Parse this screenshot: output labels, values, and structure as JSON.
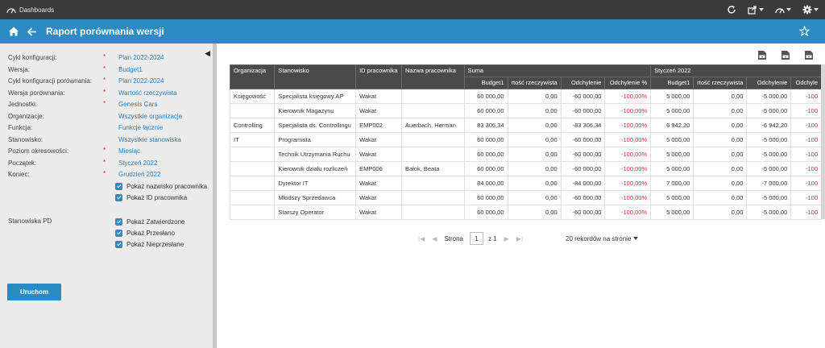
{
  "topbar": {
    "app_name": "Dashboards"
  },
  "header": {
    "title": "Raport porównania wersji"
  },
  "params": [
    {
      "label": "Cykl konfiguracji:",
      "required": "*",
      "value": "Plan 2022-2024"
    },
    {
      "label": "Wersja:",
      "required": "*",
      "value": "Budget1"
    },
    {
      "label": "Cykl konfiguracji porównania:",
      "required": "*",
      "value": "Plan 2022-2024"
    },
    {
      "label": "Wersja porównania:",
      "required": "*",
      "value": "Wartość rzeczywista"
    },
    {
      "label": "Jednostki:",
      "required": "*",
      "value": "Genesis Cars"
    },
    {
      "label": "Organizacje:",
      "required": "",
      "value": "Wszystkie organizacje"
    },
    {
      "label": "Funkcja:",
      "required": "",
      "value": "Funkcje łącznie"
    },
    {
      "label": "Stanowisko:",
      "required": "",
      "value": "Wszystkie stanowiska"
    },
    {
      "label": "Poziom okresowości:",
      "required": "*",
      "value": "Miesiąc"
    },
    {
      "label": "Początek:",
      "required": "*",
      "value": "Styczeń 2022"
    },
    {
      "label": "Koniec:",
      "required": "*",
      "value": "Grudzień 2022"
    }
  ],
  "checks1": [
    "Pokaż nazwisko pracownika",
    "Pokaż ID pracownika"
  ],
  "pd_label": "Stanowiska PD",
  "checks2": [
    "Pokaż Zatwierdzone",
    "Pokaż Przesłano",
    "Pokaż Nieprzesłane"
  ],
  "run_label": "Uruchom",
  "table": {
    "group_headers": {
      "suma": "Suma",
      "jan": "Styczeń 2022"
    },
    "base_headers": [
      "Organizacja",
      "Stanowisko",
      "ID pracownika",
      "Nazwa pracownika"
    ],
    "sub_headers": [
      "Budget1",
      "rtość rzeczywista",
      "Odchylenie",
      "Odchylenie %",
      "Budget1",
      "rtość rzeczywista",
      "Odchylenie",
      "Odchyle"
    ],
    "rows": [
      [
        "Księgowość",
        "Specjalista księgowy AP",
        "Wakat",
        "",
        "60 000,00",
        "0,00",
        "-60 000,00",
        "-100,00%",
        "5 000,00",
        "0,00",
        "-5 000,00",
        "-100"
      ],
      [
        "",
        "Kierownik Magazynu",
        "Wakat",
        "",
        "60 000,00",
        "0,00",
        "-60 000,00",
        "-100,00%",
        "5 000,00",
        "0,00",
        "-5 000,00",
        "-100"
      ],
      [
        "Controlling",
        "Specjalista ds. Controllingu",
        "EMP002",
        "Auerbach, Herman",
        "83 306,34",
        "0,00",
        "-83 306,34",
        "-100,00%",
        "6 942,20",
        "0,00",
        "-6 942,20",
        "-100"
      ],
      [
        "IT",
        "Programista",
        "Wakat",
        "",
        "60 000,00",
        "0,00",
        "-60 000,00",
        "-100,00%",
        "5 000,00",
        "0,00",
        "-5 000,00",
        "-100"
      ],
      [
        "",
        "Technik Utrzymania Ruchu",
        "Wakat",
        "",
        "60 000,00",
        "0,00",
        "-60 000,00",
        "-100,00%",
        "5 000,00",
        "0,00",
        "-5 000,00",
        "-100"
      ],
      [
        "",
        "Kierownik działu rozliczeń",
        "EMP006",
        "Bałok, Beata",
        "60 000,00",
        "0,00",
        "-60 000,00",
        "-100,00%",
        "5 000,00",
        "0,00",
        "-5 000,00",
        "-100"
      ],
      [
        "",
        "Dyrektor IT",
        "Wakat",
        "",
        "84 000,00",
        "0,00",
        "-84 000,00",
        "-100,00%",
        "7 000,00",
        "0,00",
        "-7 000,00",
        "-100"
      ],
      [
        "",
        "Młodszy Sprzedawca",
        "Wakat",
        "",
        "60 000,00",
        "0,00",
        "-60 000,00",
        "-100,00%",
        "5 000,00",
        "0,00",
        "-5 000,00",
        "-100"
      ],
      [
        "",
        "Starszy Operator",
        "Wakat",
        "",
        "60 000,00",
        "0,00",
        "-60 000,00",
        "-100,00%",
        "5 000,00",
        "0,00",
        "-5 000,00",
        "-100"
      ]
    ]
  },
  "pager": {
    "page_label": "Strona",
    "page": "1",
    "of_label": "z 1",
    "per_page": "20 rekordów na stronie"
  }
}
